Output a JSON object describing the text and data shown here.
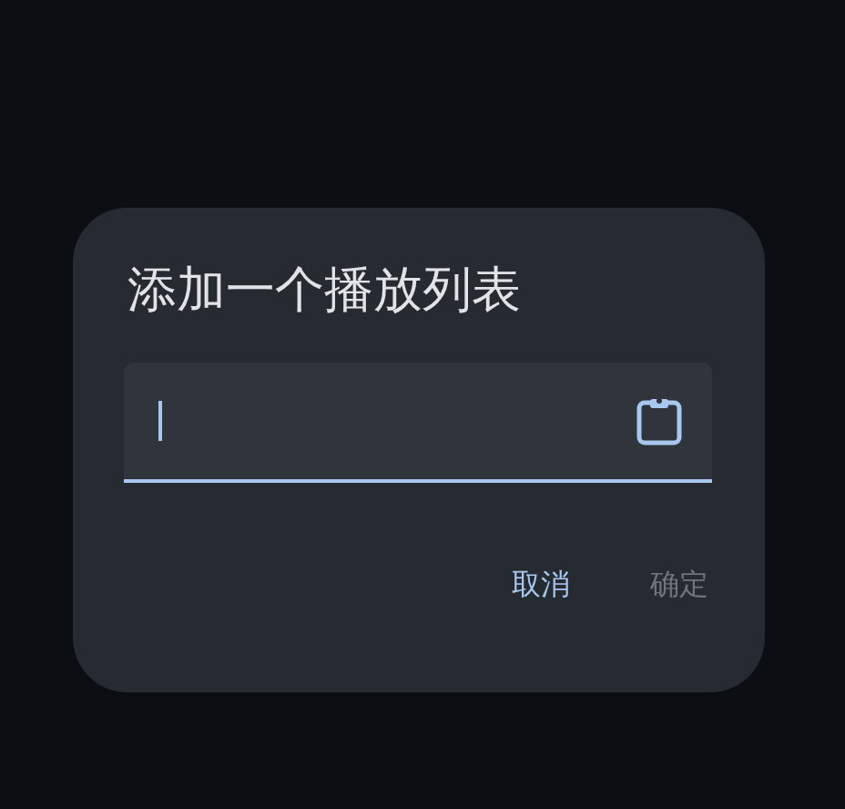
{
  "dialog": {
    "title": "添加一个播放列表",
    "field": {
      "focused": true
    },
    "buttons": [
      {
        "label": "取消",
        "disabled": false
      },
      {
        "label": "确定",
        "disabled": true
      }
    ]
  }
}
